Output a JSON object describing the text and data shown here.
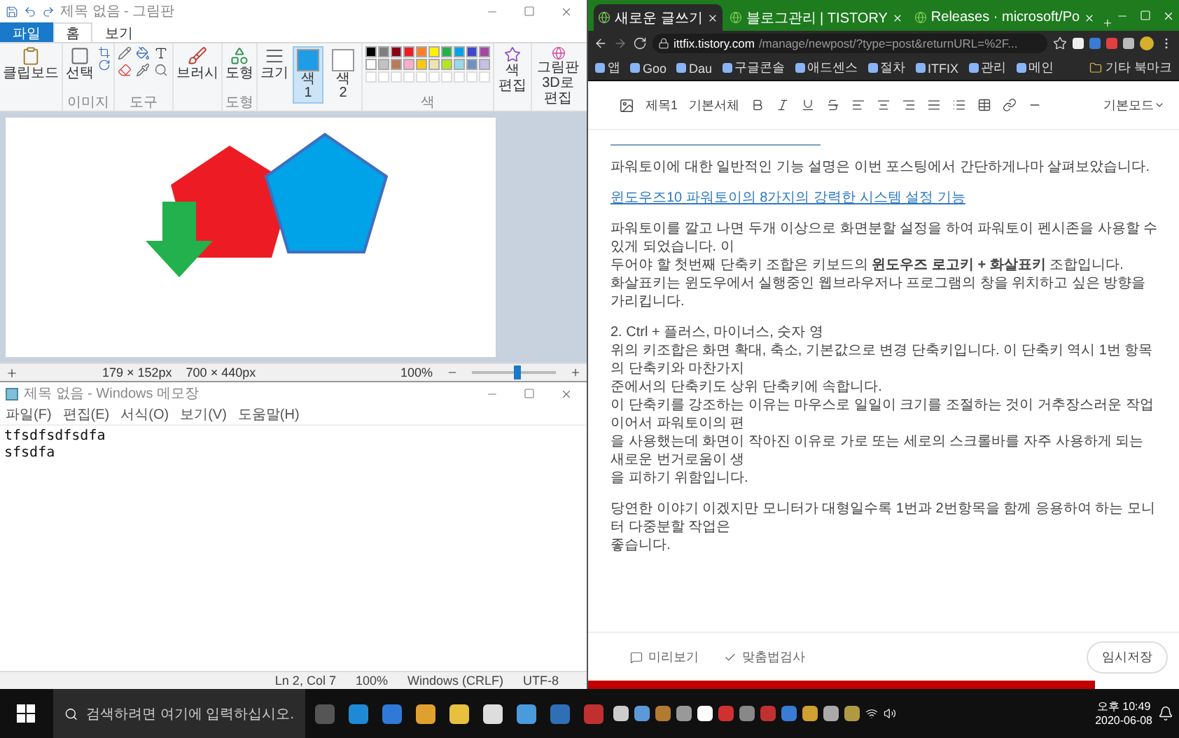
{
  "paint": {
    "title": "제목 없음 - 그림판",
    "tabs": [
      {
        "label": "파일",
        "selected": false,
        "kind": "file"
      },
      {
        "label": "홈",
        "selected": true,
        "kind": "tab"
      },
      {
        "label": "보기",
        "selected": false,
        "kind": "tab"
      }
    ],
    "ribbon": {
      "clipboard": "클립보드",
      "select": "선택",
      "image_group": "이미지",
      "tools_group": "도구",
      "brush": "브러시",
      "shapes": "도형",
      "shapes_group": "도형",
      "size": "크기",
      "colors_group": "색",
      "edit_colors": "색 편집",
      "paint3d": "그림판 3D로 편집"
    },
    "color_slots": [
      {
        "label": "색 1",
        "color": "#1e9ce6",
        "selected": true
      },
      {
        "label": "색 2",
        "color": "#ffffff",
        "selected": false
      }
    ],
    "palette": [
      {
        "color": "#000000"
      },
      {
        "color": "#7f7f7f"
      },
      {
        "color": "#880015"
      },
      {
        "color": "#ed1c24"
      },
      {
        "color": "#ff7f27"
      },
      {
        "color": "#fff200"
      },
      {
        "color": "#22b14c"
      },
      {
        "color": "#00a2e8"
      },
      {
        "color": "#3f48cc"
      },
      {
        "color": "#a349a4"
      },
      {
        "color": "#ffffff"
      },
      {
        "color": "#c3c3c3"
      },
      {
        "color": "#b97a57"
      },
      {
        "color": "#ffaec9"
      },
      {
        "color": "#ffc90e"
      },
      {
        "color": "#efe4b0"
      },
      {
        "color": "#b5e61d"
      },
      {
        "color": "#99d9ea"
      },
      {
        "color": "#7092be"
      },
      {
        "color": "#c8bfe7"
      }
    ],
    "status": {
      "selection": "179 × 152px",
      "canvas_size": "700 × 440px",
      "zoom": "100%"
    },
    "zoom_slider": {
      "level": 0.55
    }
  },
  "notepad": {
    "title": "제목 없음 - Windows 메모장",
    "menu": [
      "파일(F)",
      "편집(E)",
      "서식(O)",
      "보기(V)",
      "도움말(H)"
    ],
    "lines": [
      "tfsdfsdfsdfa",
      "sfsdfa"
    ],
    "status": [
      "Ln 2, Col 7",
      "100%",
      "Windows (CRLF)",
      "UTF-8"
    ]
  },
  "browser": {
    "tabs": [
      {
        "label": "새로운 글쓰기",
        "selected": true
      },
      {
        "label": "블로그관리 | TISTORY",
        "selected": false
      },
      {
        "label": "Releases · microsoft/Po",
        "selected": false
      }
    ],
    "url_host": "ittfix.tistory.com",
    "url_path": "/manage/newpost/?type=post&returnURL=%2F...",
    "bookmarks": [
      "앱",
      "Goo",
      "Dau",
      "구글콘솔",
      "애드센스",
      "절차",
      "ITFIX",
      "관리",
      "메인"
    ],
    "other_bookmarks": "기타 북마크",
    "editor": {
      "heading": "제목1",
      "font": "기본서체",
      "mode": "기본모드",
      "paragraphs": [
        {
          "kind": "text",
          "lines": [
            "파워토이에 대한 일반적인 기능 설명은 이번 포스팅에서 간단하게나마 살펴보았습니다."
          ]
        },
        {
          "kind": "link",
          "lines": [
            "윈도우즈10 파워토이의 8가지의 강력한 시스템 설정 기능"
          ]
        },
        {
          "kind": "text",
          "lines": [
            "파워토이를 깔고 나면 두개 이상으로 화면분할 설정을 하여 파워토이 펜시존을 사용할 수 있게 되었습니다. 이",
            "두어야 할 첫번째 단축키 조합은 키보드의 **윈도우즈 로고키 + 화살표키** 조합입니다.",
            "화살표키는 윈도우에서 실행중인 웹브라우저나 프로그램의 창을 위치하고 싶은 방향을 가리킵니다."
          ]
        },
        {
          "kind": "text",
          "lines": [
            "2. Ctrl + 플러스, 마이너스, 숫자 영",
            "위의 키조합은 화면 확대, 축소, 기본값으로 변경 단축키입니다. 이 단축키 역시 1번 항목의 단축키와 마찬가지",
            "준에서의 단축키도 상위 단축키에 속합니다.",
            "이 단축키를 강조하는 이유는 마우스로 일일이 크기를 조절하는 것이 거추장스러운 작업이어서 파워토이의 편",
            "을 사용했는데 화면이 작아진 이유로 가로 또는 세로의 스크롤바를 자주 사용하게 되는 새로운 번거로움이 생",
            "을 피하기 위함입니다."
          ]
        },
        {
          "kind": "text",
          "lines": [
            "당연한 이야기 이겠지만 모니터가 대형일수록 1번과 2번항목을 함께 응용하여 하는 모니터 다중분할 작업은",
            "좋습니다."
          ]
        }
      ],
      "preview": "미리보기",
      "spellcheck": "맞춤법검사",
      "save": "임시저장"
    }
  },
  "taskbar": {
    "search_placeholder": "검색하려면 여기에 입력하십시오.",
    "time": "오후 10:49",
    "date": "2020-06-08"
  }
}
